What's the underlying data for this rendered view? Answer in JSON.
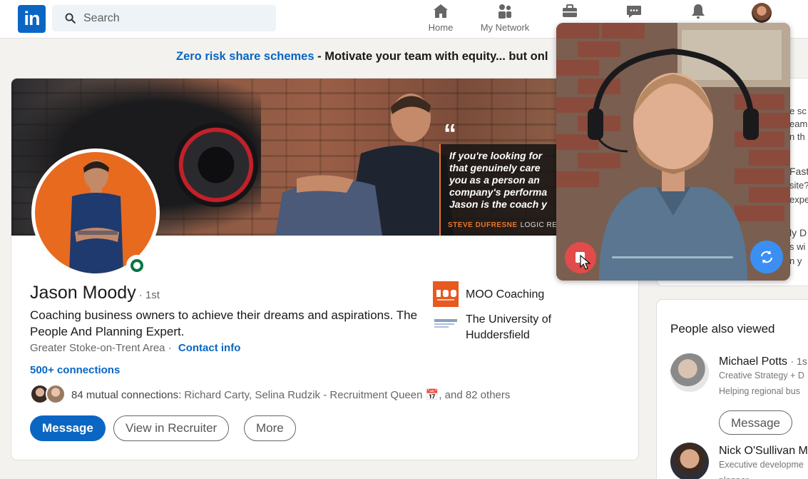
{
  "nav": {
    "logo": "in",
    "search_placeholder": "Search",
    "items": [
      {
        "label": "Home",
        "icon": "home-icon"
      },
      {
        "label": "My Network",
        "icon": "network-icon"
      },
      {
        "label": "",
        "icon": "jobs-icon"
      },
      {
        "label": "",
        "icon": "messaging-icon"
      },
      {
        "label": "",
        "icon": "notifications-icon"
      }
    ]
  },
  "promo": {
    "title": "Zero risk share schemes",
    "separator": " - ",
    "text": "Motivate your team with equity... but onl"
  },
  "profile": {
    "cover_quote": {
      "mark": "“",
      "lines": [
        "If you're looking for",
        "that genuinely care",
        "you as a person an",
        "company's performa",
        "Jason is the coach y"
      ],
      "attribution": "STEVE DUFRESNE",
      "attribution_org": "LOGIC RE"
    },
    "name": "Jason Moody",
    "degree": "· 1st",
    "headline": "Coaching business owners to achieve their dreams and aspirations. The People And Planning Expert.",
    "location": "Greater Stoke-on-Trent Area",
    "location_sep": " · ",
    "contact_info": "Contact info",
    "connections": "500+ connections",
    "mutual_label": "84 mutual connections:",
    "mutual_names": " Richard Carty, Selina Rudzik - Recruitment Queen 📅, and 82 others",
    "buttons": {
      "message": "Message",
      "recruiter": "View in Recruiter",
      "more": "More"
    },
    "experience": [
      {
        "name": "MOO Coaching",
        "logo": "moo-coaching-logo"
      },
      {
        "name": "The University of Huddersfield",
        "logo": "university-logo"
      }
    ]
  },
  "sidebar": {
    "fragments": [
      "e sc",
      "eam",
      "n th",
      "Fast",
      "site?",
      "expe",
      "ly D",
      "s wi",
      "n y"
    ],
    "people_also_viewed_title": "People also viewed",
    "people": [
      {
        "name": "Michael Potts",
        "degree": "· 1s",
        "line1": "Creative Strategy + D",
        "line2": "Helping regional bus",
        "button": "Message"
      },
      {
        "name": "Nick O'Sullivan M",
        "degree": "",
        "line1": "Executive developme",
        "line2": "planner",
        "button": ""
      }
    ]
  },
  "video": {
    "progress": 0.0
  },
  "colors": {
    "brand": "#0a66c2",
    "online": "#057642",
    "record": "#e24b4b",
    "flip": "#3b8ff2",
    "orange": "#e86a1f"
  }
}
